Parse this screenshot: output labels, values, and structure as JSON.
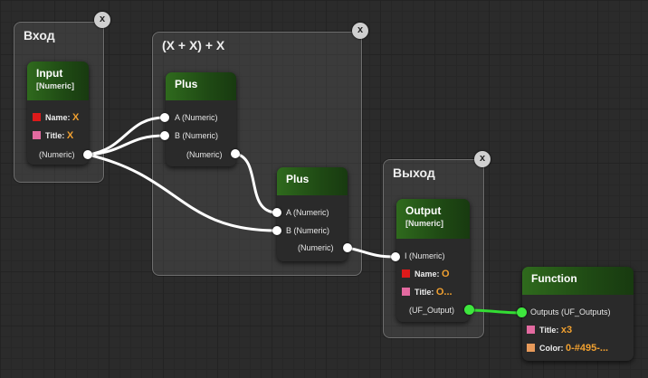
{
  "colors": {
    "wire": "#ffffff",
    "active_wire": "#33dd33",
    "node_header": "#2f6a1d",
    "value": "#f0a030",
    "swatch_red": "#dd1a1a",
    "swatch_pink": "#e36aa0",
    "swatch_orange": "#e89a5a"
  },
  "close_label": "x",
  "groups": {
    "input": {
      "title": "Вход"
    },
    "expr": {
      "title": "(X + X) + X"
    },
    "output": {
      "title": "Выход"
    }
  },
  "nodes": {
    "input": {
      "title": "Input",
      "subtitle": "[Numeric]",
      "name_label": "Name:",
      "name_value": "X",
      "title_label": "Title:",
      "title_value": "X",
      "out_label": "(Numeric)"
    },
    "plus1": {
      "title": "Plus",
      "in_a": "A (Numeric)",
      "in_b": "B (Numeric)",
      "out": "(Numeric)"
    },
    "plus2": {
      "title": "Plus",
      "in_a": "A (Numeric)",
      "in_b": "B (Numeric)",
      "out": "(Numeric)"
    },
    "output": {
      "title": "Output",
      "subtitle": "[Numeric]",
      "in_i": "I (Numeric)",
      "name_label": "Name:",
      "name_value": "O",
      "title_label": "Title:",
      "title_value": "O...",
      "out_label": "(UF_Output)"
    },
    "function": {
      "title": "Function",
      "in_outputs": "Outputs (UF_Outputs)",
      "title_label": "Title:",
      "title_value": "x3",
      "color_label": "Color:",
      "color_value": "0-#495-..."
    }
  }
}
